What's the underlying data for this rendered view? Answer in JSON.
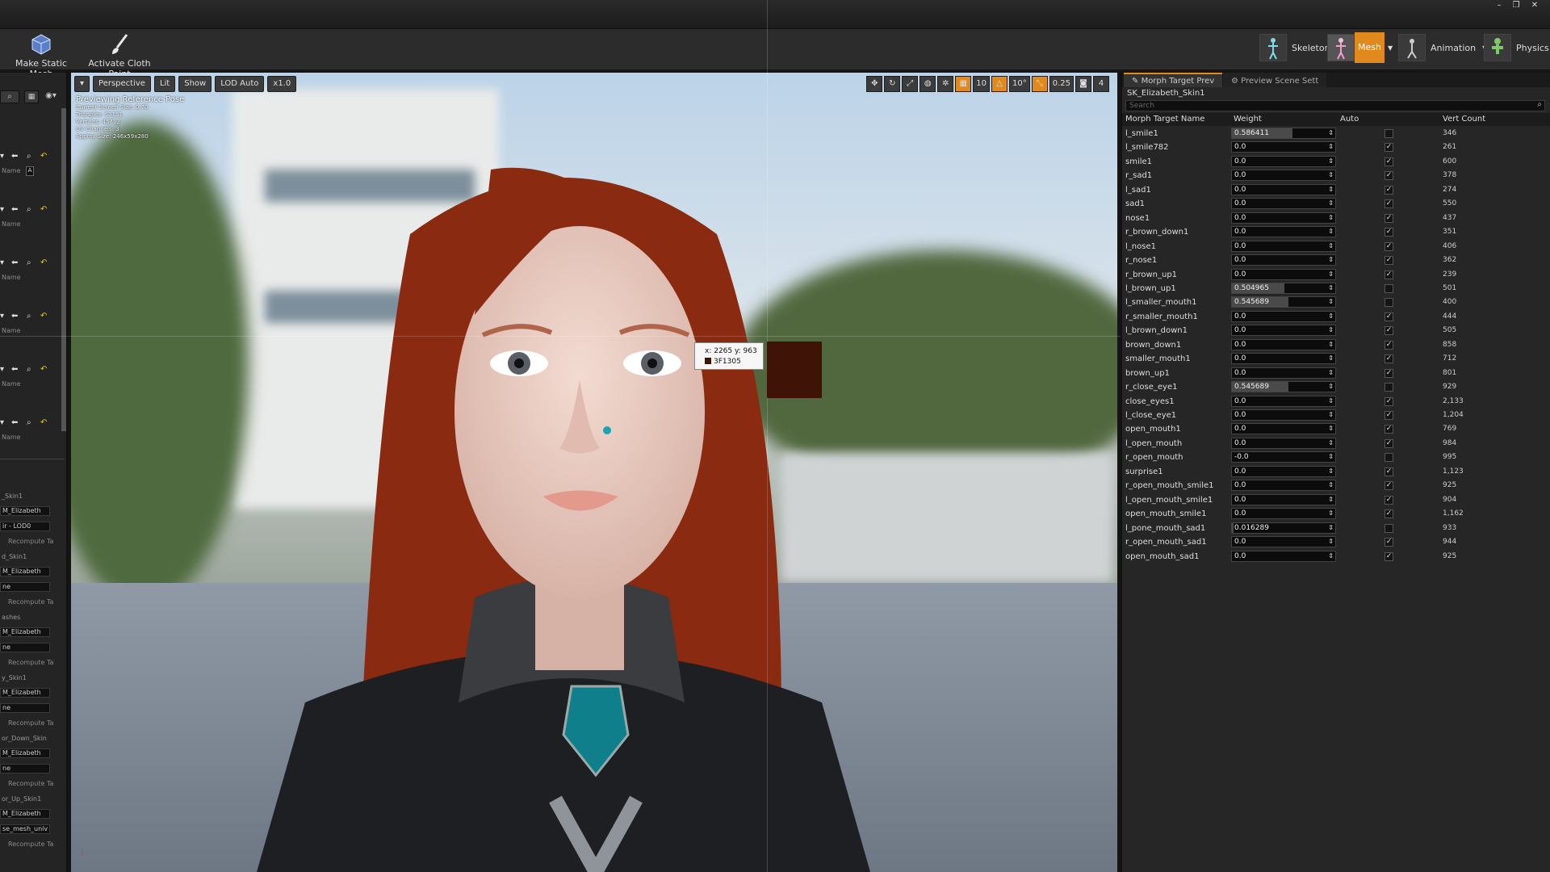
{
  "toolbar": {
    "make_static_mesh": "Make Static Mesh",
    "activate_cloth_paint": "Activate Cloth Paint",
    "modes": [
      {
        "label": "Skeleton",
        "active": false
      },
      {
        "label": "Mesh",
        "active": true
      },
      {
        "label": "Animation",
        "active": false
      },
      {
        "label": "Physics",
        "active": false
      }
    ]
  },
  "viewport": {
    "perspective": "Perspective",
    "lit": "Lit",
    "show": "Show",
    "lod": "LOD Auto",
    "speed": "x1.0",
    "info_title": "Previewing Reference Pose",
    "info_lines": [
      "Current Screen Size: 0.70",
      "Triangles: 53151",
      "Vertices: 45712",
      "UV Channels: 3",
      "Approx Size: 246x59x280"
    ],
    "grid_snap": "10",
    "rot_snap": "10°",
    "scale_snap": "0.25",
    "cam_speed": "4",
    "tooltip_coords": "x: 2265  y: 963",
    "tooltip_hex": "3F1305"
  },
  "left_panel": {
    "name_label": "Name",
    "recompute": "Recompute Ta",
    "sections": [
      {
        "title": "_Skin1",
        "mat": "M_Elizabeth",
        "sub": "ir - LOD0"
      },
      {
        "title": "d_Skin1",
        "mat": "M_Elizabeth",
        "sub": "ne"
      },
      {
        "title": "ashes",
        "mat": "M_Elizabeth",
        "sub": "ne"
      },
      {
        "title": "y_Skin1",
        "mat": "M_Elizabeth",
        "sub": "ne"
      },
      {
        "title": "or_Down_Skin",
        "mat": "M_Elizabeth",
        "sub": "ne"
      },
      {
        "title": "or_Up_Skin1",
        "mat": "M_Elizabeth",
        "sub": "se_mesh_univ"
      }
    ]
  },
  "right_panel": {
    "tabs": [
      "Morph Target Prev",
      "Preview Scene Sett"
    ],
    "mesh_name": "SK_Elizabeth_Skin1",
    "search_placeholder": "Search",
    "columns": [
      "Morph Target Name",
      "Weight",
      "Auto",
      "Vert Count"
    ],
    "morphs": [
      {
        "name": "l_smile1",
        "weight": "0.586411",
        "w": 0.586411,
        "auto": false,
        "count": "346"
      },
      {
        "name": "l_smile782",
        "weight": "0.0",
        "w": 0,
        "auto": true,
        "count": "261"
      },
      {
        "name": "smile1",
        "weight": "0.0",
        "w": 0,
        "auto": true,
        "count": "600"
      },
      {
        "name": "r_sad1",
        "weight": "0.0",
        "w": 0,
        "auto": true,
        "count": "378"
      },
      {
        "name": "l_sad1",
        "weight": "0.0",
        "w": 0,
        "auto": true,
        "count": "274"
      },
      {
        "name": "sad1",
        "weight": "0.0",
        "w": 0,
        "auto": true,
        "count": "550"
      },
      {
        "name": "nose1",
        "weight": "0.0",
        "w": 0,
        "auto": true,
        "count": "437"
      },
      {
        "name": "r_brown_down1",
        "weight": "0.0",
        "w": 0,
        "auto": true,
        "count": "351"
      },
      {
        "name": "l_nose1",
        "weight": "0.0",
        "w": 0,
        "auto": true,
        "count": "406"
      },
      {
        "name": "r_nose1",
        "weight": "0.0",
        "w": 0,
        "auto": true,
        "count": "362"
      },
      {
        "name": "r_brown_up1",
        "weight": "0.0",
        "w": 0,
        "auto": true,
        "count": "239"
      },
      {
        "name": "l_brown_up1",
        "weight": "0.504965",
        "w": 0.504965,
        "auto": false,
        "count": "501"
      },
      {
        "name": "l_smaller_mouth1",
        "weight": "0.545689",
        "w": 0.545689,
        "auto": false,
        "count": "400"
      },
      {
        "name": "r_smaller_mouth1",
        "weight": "0.0",
        "w": 0,
        "auto": true,
        "count": "444"
      },
      {
        "name": "l_brown_down1",
        "weight": "0.0",
        "w": 0,
        "auto": true,
        "count": "505"
      },
      {
        "name": "brown_down1",
        "weight": "0.0",
        "w": 0,
        "auto": true,
        "count": "858"
      },
      {
        "name": "smaller_mouth1",
        "weight": "0.0",
        "w": 0,
        "auto": true,
        "count": "712"
      },
      {
        "name": "brown_up1",
        "weight": "0.0",
        "w": 0,
        "auto": true,
        "count": "801"
      },
      {
        "name": "r_close_eye1",
        "weight": "0.545689",
        "w": 0.545689,
        "auto": false,
        "count": "929"
      },
      {
        "name": "close_eyes1",
        "weight": "0.0",
        "w": 0,
        "auto": true,
        "count": "2,133"
      },
      {
        "name": "l_close_eye1",
        "weight": "0.0",
        "w": 0,
        "auto": true,
        "count": "1,204"
      },
      {
        "name": "open_mouth1",
        "weight": "0.0",
        "w": 0,
        "auto": true,
        "count": "769"
      },
      {
        "name": "l_open_mouth",
        "weight": "0.0",
        "w": 0,
        "auto": true,
        "count": "984"
      },
      {
        "name": "r_open_mouth",
        "weight": "-0.0",
        "w": 0,
        "auto": false,
        "count": "995"
      },
      {
        "name": "surprise1",
        "weight": "0.0",
        "w": 0,
        "auto": true,
        "count": "1,123"
      },
      {
        "name": "r_open_mouth_smile1",
        "weight": "0.0",
        "w": 0,
        "auto": true,
        "count": "925"
      },
      {
        "name": "l_open_mouth_smile1",
        "weight": "0.0",
        "w": 0,
        "auto": true,
        "count": "904"
      },
      {
        "name": "open_mouth_smile1",
        "weight": "0.0",
        "w": 0,
        "auto": true,
        "count": "1,162"
      },
      {
        "name": "l_pone_mouth_sad1",
        "weight": "0.016289",
        "w": 0.016289,
        "auto": false,
        "count": "933"
      },
      {
        "name": "r_open_mouth_sad1",
        "weight": "0.0",
        "w": 0,
        "auto": true,
        "count": "944"
      },
      {
        "name": "open_mouth_sad1",
        "weight": "0.0",
        "w": 0,
        "auto": true,
        "count": "925"
      }
    ]
  },
  "colors": {
    "accent": "#e08a1e",
    "picked": "#3F1305"
  }
}
